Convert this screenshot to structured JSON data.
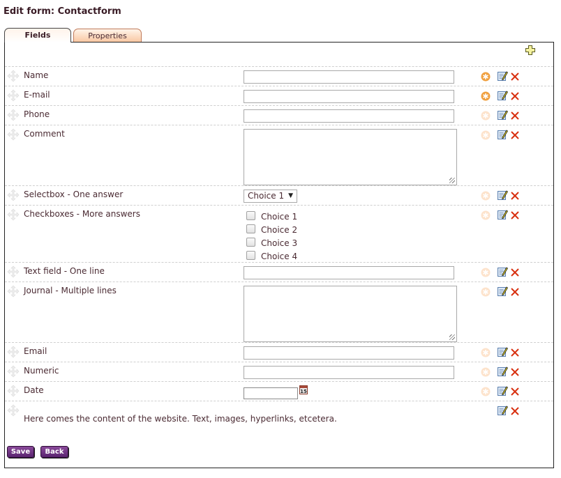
{
  "page": {
    "title": "Edit form: Contactform"
  },
  "tabs": [
    {
      "label": "Fields",
      "active": true
    },
    {
      "label": "Properties",
      "active": false
    }
  ],
  "toolbar": {
    "add_icon": "add-field-icon"
  },
  "fields": [
    {
      "label": "Name",
      "type": "text",
      "required": true
    },
    {
      "label": "E-mail",
      "type": "text",
      "required": true
    },
    {
      "label": "Phone",
      "type": "text",
      "required": false
    },
    {
      "label": "Comment",
      "type": "textarea",
      "required": false
    },
    {
      "label": "Selectbox - One answer",
      "type": "select",
      "required": false,
      "selected": "Choice 1"
    },
    {
      "label": "Checkboxes - More answers",
      "type": "checkboxes",
      "required": false,
      "options": [
        "Choice 1",
        "Choice 2",
        "Choice 3",
        "Choice 4"
      ]
    },
    {
      "label": "Text field - One line",
      "type": "text",
      "required": false
    },
    {
      "label": "Journal - Multiple lines",
      "type": "textarea",
      "required": false
    },
    {
      "label": "Email",
      "type": "text",
      "required": false
    },
    {
      "label": "Numeric",
      "type": "text",
      "required": false
    },
    {
      "label": "Date",
      "type": "date",
      "required": false,
      "calendar_icon_text": "15"
    },
    {
      "label": "",
      "type": "content",
      "content": "Here comes the content of the website. Text, images, hyperlinks, etcetera."
    }
  ],
  "buttons": {
    "save": "Save",
    "back": "Back"
  },
  "colors": {
    "required_active": "#f0a040",
    "required_inactive": "#fde3cc",
    "delete": "#d83010",
    "button": "#6a2f80"
  }
}
